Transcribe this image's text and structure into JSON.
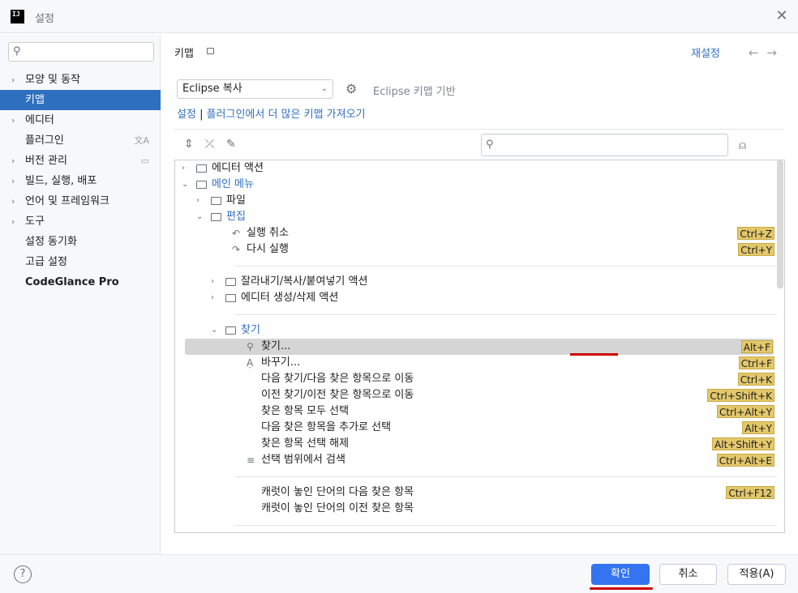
{
  "window": {
    "title": "설정",
    "app_icon_text": "IJ"
  },
  "sidebar": {
    "items": [
      {
        "label": "모양 및 동작",
        "expandable": true
      },
      {
        "label": "키맵",
        "active": true
      },
      {
        "label": "에디터",
        "expandable": true
      },
      {
        "label": "플러그인",
        "right_icon": "translate-icon",
        "right_glyph": "文A"
      },
      {
        "label": "버전 관리",
        "expandable": true,
        "right_icon": "window-icon",
        "right_glyph": "▭"
      },
      {
        "label": "빌드, 실행, 배포",
        "expandable": true
      },
      {
        "label": "언어 및 프레임워크",
        "expandable": true
      },
      {
        "label": "도구",
        "expandable": true
      },
      {
        "label": "설정 동기화"
      },
      {
        "label": "고급 설정"
      },
      {
        "label": "CodeGlance Pro",
        "bold": true
      }
    ]
  },
  "header": {
    "breadcrumb": "키맵",
    "reset_label": "재설정",
    "back_glyph": "←",
    "forward_glyph": "→"
  },
  "keymap": {
    "selected": "Eclipse 복사",
    "based_on": "Eclipse 키맵 기반",
    "import_prefix": "설정",
    "import_sep": "|",
    "import_link": "플러그인에서 더 많은 키맵 가져오기"
  },
  "toolbar": {
    "expand_glyph": "⌃",
    "collapse_glyph": "✕",
    "edit_glyph": "✎",
    "find_glyph": "⍝"
  },
  "tree": {
    "rows": [
      {
        "indent": 0,
        "chev": "›",
        "folder": true,
        "label": "에디터 액션"
      },
      {
        "indent": 0,
        "chev": "⌄",
        "folder": true,
        "label": "메인 메뉴",
        "blue": true
      },
      {
        "indent": 1,
        "chev": "›",
        "folder": true,
        "label": "파일"
      },
      {
        "indent": 1,
        "chev": "⌄",
        "folder": true,
        "label": "편집",
        "blue": true
      },
      {
        "indent": 2,
        "icon": "undo-icon",
        "glyph": "↶",
        "label": "실행 취소",
        "shortcut": "Ctrl+Z"
      },
      {
        "indent": 2,
        "icon": "redo-icon",
        "glyph": "↷",
        "label": "다시 실행",
        "shortcut": "Ctrl+Y"
      },
      {
        "divider": true
      },
      {
        "indent": 2,
        "chev": "›",
        "folder": true,
        "label": "잘라내기/복사/붙여넣기 액션"
      },
      {
        "indent": 2,
        "chev": "›",
        "folder": true,
        "label": "에디터 생성/삭제 액션"
      },
      {
        "divider": true
      },
      {
        "indent": 2,
        "chev": "⌄",
        "folder": true,
        "label": "찾기",
        "blue": true
      },
      {
        "indent": 3,
        "icon": "search-icon",
        "glyph": "⚲",
        "label": "찾기...",
        "shortcut": "Alt+F",
        "selected": true
      },
      {
        "indent": 3,
        "icon": "replace-icon",
        "glyph": "Ạ",
        "label": "바꾸기...",
        "shortcut": "Ctrl+F"
      },
      {
        "indent": 3,
        "label": "다음 찾기/다음 찾은 항목으로 이동",
        "shortcut": "Ctrl+K"
      },
      {
        "indent": 3,
        "label": "이전 찾기/이전 찾은 항목으로 이동",
        "shortcut": "Ctrl+Shift+K"
      },
      {
        "indent": 3,
        "label": "찾은 항목 모두 선택",
        "shortcut": "Ctrl+Alt+Y"
      },
      {
        "indent": 3,
        "label": "다음 찾은 항목을 추가로 선택",
        "shortcut": "Alt+Y"
      },
      {
        "indent": 3,
        "label": "찾은 항목 선택 해제",
        "shortcut": "Alt+Shift+Y"
      },
      {
        "indent": 3,
        "icon": "find-in-selection-icon",
        "glyph": "≡",
        "label": "선택 범위에서 검색",
        "shortcut": "Ctrl+Alt+E"
      },
      {
        "divider": true
      },
      {
        "indent": 3,
        "label": "캐럿이 놓인 단어의 다음 찾은 항목",
        "shortcut": "Ctrl+F12"
      },
      {
        "indent": 3,
        "label": "캐럿이 놓인 단어의 이전 찾은 항목"
      },
      {
        "divider": true
      }
    ]
  },
  "footer": {
    "help": "?",
    "ok": "확인",
    "cancel": "취소",
    "apply": "적용(A)"
  },
  "colors": {
    "accent": "#3574f0",
    "selection": "#2f6fbf",
    "shortcut_bg": "#e3c86b",
    "annotation_red": "#cc0000"
  }
}
